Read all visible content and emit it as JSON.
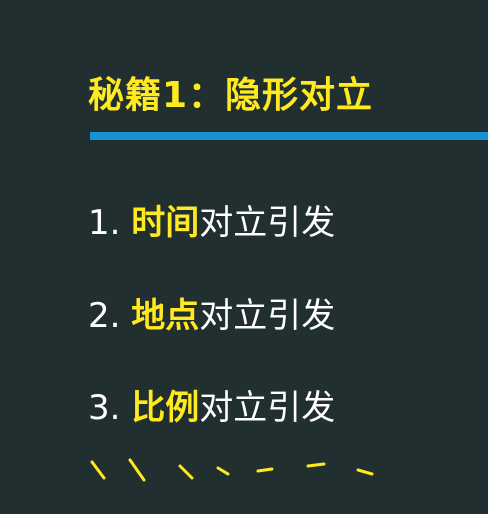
{
  "slide": {
    "title": "秘籍1：隐形对立",
    "accent_color": "#ffea1f",
    "rule_color": "#1793d4",
    "items": [
      {
        "number": "1.",
        "highlight": "时间",
        "rest": "对立引发"
      },
      {
        "number": "2.",
        "highlight": "地点",
        "rest": "对立引发"
      },
      {
        "number": "3.",
        "highlight": "比例",
        "rest": "对立引发"
      }
    ]
  }
}
